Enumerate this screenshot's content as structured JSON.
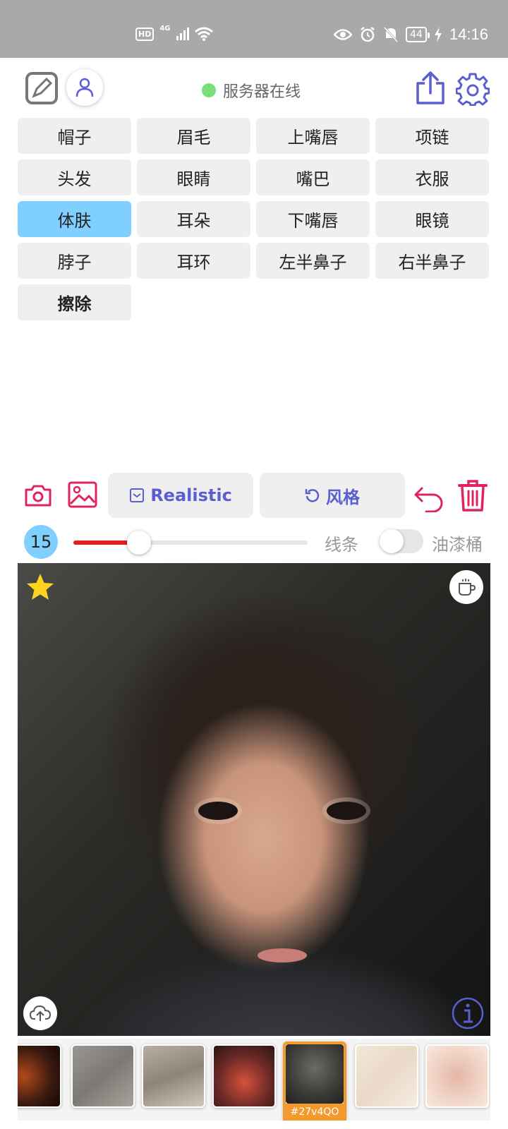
{
  "status_bar": {
    "hd": "HD",
    "network": "4G",
    "battery": "44",
    "time": "14:16",
    "icons": [
      "hd-icon",
      "signal-icon",
      "wifi-icon",
      "eye-icon",
      "alarm-icon",
      "mute-icon",
      "battery-icon",
      "charging-icon"
    ]
  },
  "header": {
    "server_status": "服务器在线",
    "status_color": "#7be07b"
  },
  "segments": [
    {
      "label": "帽子",
      "active": false
    },
    {
      "label": "眉毛",
      "active": false
    },
    {
      "label": "上嘴唇",
      "active": false
    },
    {
      "label": "项链",
      "active": false
    },
    {
      "label": "头发",
      "active": false
    },
    {
      "label": "眼睛",
      "active": false
    },
    {
      "label": "嘴巴",
      "active": false
    },
    {
      "label": "衣服",
      "active": false
    },
    {
      "label": "体肤",
      "active": true
    },
    {
      "label": "耳朵",
      "active": false
    },
    {
      "label": "下嘴唇",
      "active": false
    },
    {
      "label": "眼镜",
      "active": false
    },
    {
      "label": "脖子",
      "active": false
    },
    {
      "label": "耳环",
      "active": false
    },
    {
      "label": "左半鼻子",
      "active": false
    },
    {
      "label": "右半鼻子",
      "active": false
    },
    {
      "label": "擦除",
      "active": false
    }
  ],
  "tools": {
    "realistic_label": "Realistic",
    "style_label": "风格",
    "accent_color": "#5a5fd0",
    "danger_color": "#e0245e"
  },
  "brush": {
    "size": "15",
    "slider_fraction": 0.28,
    "line_label": "线条",
    "bucket_label": "油漆桶",
    "bucket_enabled": false
  },
  "thumbnails": {
    "selected_tag": "#27v4QO",
    "selected_index": 4,
    "count": 7
  },
  "colors": {
    "active_segment": "#7fcfff",
    "segment_bg": "#efefef",
    "selected_thumb": "#f29a2e"
  }
}
